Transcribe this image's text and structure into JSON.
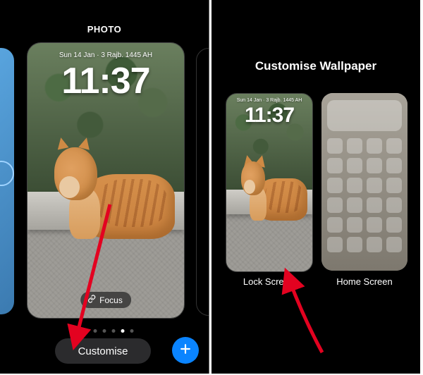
{
  "left": {
    "header_label": "PHOTO",
    "lock_date": "Sun 14 Jan · 3 Rajb. 1445 AH",
    "lock_time": "11:37",
    "focus_label": "Focus",
    "customise_label": "Customise",
    "page_dots": {
      "count": 7,
      "active_index": 5
    }
  },
  "right": {
    "title": "Customise Wallpaper",
    "lock_date": "Sun 14 Jan · 3 Rajb. 1445 AH",
    "lock_time": "11:37",
    "lock_caption": "Lock Screen",
    "home_caption": "Home Screen"
  }
}
